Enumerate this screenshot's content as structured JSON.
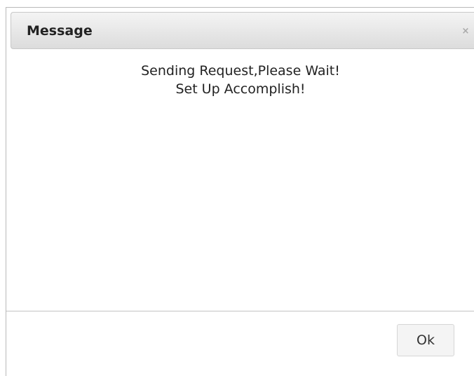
{
  "dialog": {
    "title": "Message",
    "close_symbol": "×",
    "close_icon": "close-icon",
    "message_lines": [
      "Sending Request,Please Wait!",
      "Set Up Accomplish!"
    ],
    "ok_label": "Ok"
  }
}
